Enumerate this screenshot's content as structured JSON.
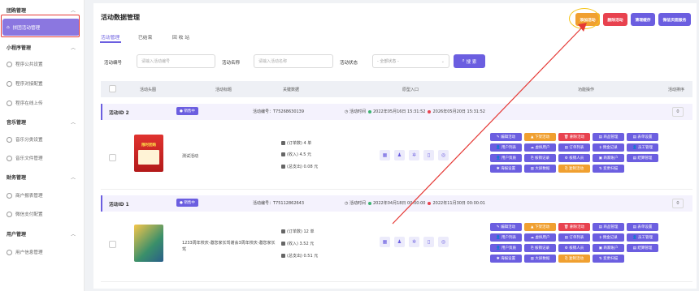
{
  "sidebar": {
    "groups": [
      {
        "title": "团购管理",
        "items": [
          {
            "label": "拼团活动管理",
            "active": true
          }
        ]
      },
      {
        "title": "小程序管理",
        "items": [
          {
            "label": "程序公共设置"
          },
          {
            "label": "程序对接配置"
          },
          {
            "label": "程序在线上传"
          }
        ]
      },
      {
        "title": "音乐管理",
        "items": [
          {
            "label": "音乐分类设置"
          },
          {
            "label": "音乐文件管理"
          }
        ]
      },
      {
        "title": "财务管理",
        "items": [
          {
            "label": "商户报表管理"
          },
          {
            "label": "微信支付配置"
          }
        ]
      },
      {
        "title": "用户管理",
        "items": [
          {
            "label": "用户信息管理"
          }
        ]
      }
    ]
  },
  "main": {
    "title": "活动数据管理",
    "tabs": [
      "活动管理",
      "已结束",
      "回 收 站"
    ],
    "top_buttons": [
      {
        "label": "添加活动",
        "color": "#f0a030"
      },
      {
        "label": "删除活动",
        "color": "#e8424f"
      },
      {
        "label": "清理缓存",
        "color": "#6b5ee0"
      },
      {
        "label": "微信页面服务",
        "color": "#6b5ee0"
      }
    ],
    "filter": {
      "id_label": "活动编号",
      "id_placeholder": "请输入活动编号",
      "name_label": "活动名称",
      "name_placeholder": "请输入活动名称",
      "status_label": "活动状态",
      "status_value": "- 全部状态 -",
      "search_label": "搜 索"
    },
    "headers": [
      "活动头图",
      "活动标题",
      "关键数据",
      "原型入口",
      "功能操作",
      "活动排序"
    ],
    "rows": [
      {
        "id_label": "活动ID",
        "id": "2",
        "badge": "● 销售中",
        "code": "活动编号：T75268630139",
        "time_label": "活动时间",
        "start": "2022年05月16日 15:31:52",
        "end": "2026年05月20日 15:31:52",
        "sort": "0",
        "title": "测试活动",
        "orders": "(订单数) 4 单",
        "income": "(收入) 4.5 元",
        "expense": "(总支出) 0.08 元",
        "thumb_text": "限时团购"
      },
      {
        "id_label": "活动ID",
        "id": "1",
        "badge": "● 销售中",
        "code": "活动编号：T75112862643",
        "time_label": "活动时间",
        "start": "2022年04月18日 00:00:00",
        "end": "2022年11月30日 00:00:01",
        "sort": "0",
        "title": "1233周年校庆-邀您家长驾谢会3周年校庆-邀您家长驾",
        "orders": "(订单数) 12 单",
        "income": "(收入) 3.52 元",
        "expense": "(总支出) 0.51 元",
        "thumb_text": ""
      }
    ],
    "ops": [
      [
        {
          "label": "✎ 编辑活动",
          "color": "#6b5ee0"
        },
        {
          "label": "▲ 下架活动",
          "color": "#f0a030"
        },
        {
          "label": "🗑 删除活动",
          "color": "#e8424f"
        },
        {
          "label": "▤ 商品管理",
          "color": "#6b5ee0"
        },
        {
          "label": "▤ 表单设置",
          "color": "#6b5ee0"
        }
      ],
      [
        {
          "label": "👤 用户列表",
          "color": "#6b5ee0"
        },
        {
          "label": "☁ 虚拟用户",
          "color": "#6b5ee0"
        },
        {
          "label": "▤ 订单列表",
          "color": "#6b5ee0"
        },
        {
          "label": "$ 佣金记录",
          "color": "#6b5ee0"
        },
        {
          "label": "👤 员工管理",
          "color": "#6b5ee0"
        }
      ],
      [
        {
          "label": "👤 用户资质",
          "color": "#6b5ee0"
        },
        {
          "label": "⎘ 核销记录",
          "color": "#6b5ee0"
        },
        {
          "label": "⚙ 核销人员",
          "color": "#6b5ee0"
        },
        {
          "label": "▣ 商家账户",
          "color": "#6b5ee0"
        },
        {
          "label": "▤ 结算管理",
          "color": "#6b5ee0"
        }
      ],
      [
        {
          "label": "✱ 海报设置",
          "color": "#6b5ee0"
        },
        {
          "label": "▥ 大屏数据",
          "color": "#6b5ee0"
        },
        {
          "label": "⎘ 复制活动",
          "color": "#f0a030"
        },
        {
          "label": "⇅ 变更扫描",
          "color": "#6b5ee0"
        }
      ]
    ]
  }
}
